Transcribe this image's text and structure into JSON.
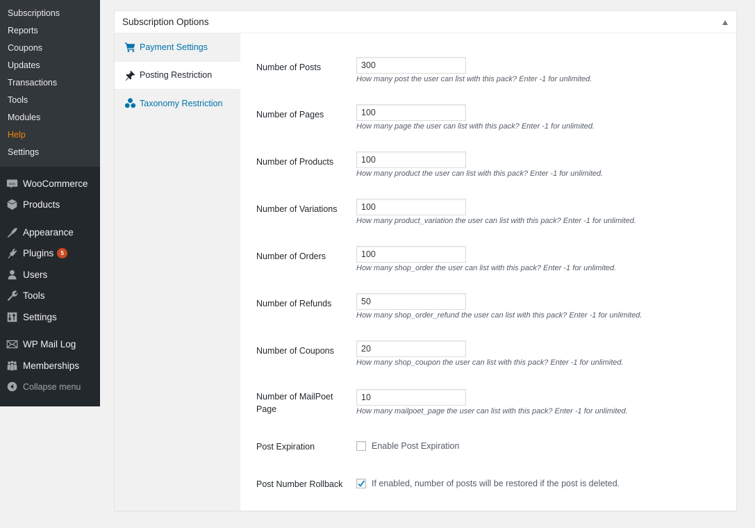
{
  "admin_menu": {
    "submenu": [
      {
        "label": "Subscriptions",
        "current": false
      },
      {
        "label": "Reports",
        "current": false
      },
      {
        "label": "Coupons",
        "current": false
      },
      {
        "label": "Updates",
        "current": false
      },
      {
        "label": "Transactions",
        "current": false
      },
      {
        "label": "Tools",
        "current": false
      },
      {
        "label": "Modules",
        "current": false
      },
      {
        "label": "Help",
        "current": true
      },
      {
        "label": "Settings",
        "current": false
      }
    ],
    "items": [
      {
        "label": "WooCommerce",
        "icon": "woocommerce-icon"
      },
      {
        "label": "Products",
        "icon": "products-box-icon"
      },
      {
        "label": "Appearance",
        "icon": "paintbrush-icon"
      },
      {
        "label": "Plugins",
        "icon": "plugin-plug-icon",
        "badge": "5"
      },
      {
        "label": "Users",
        "icon": "user-icon"
      },
      {
        "label": "Tools",
        "icon": "wrench-icon"
      },
      {
        "label": "Settings",
        "icon": "settings-sliders-icon"
      },
      {
        "label": "WP Mail Log",
        "icon": "envelope-icon"
      },
      {
        "label": "Memberships",
        "icon": "groups-icon"
      }
    ],
    "collapse_label": "Collapse menu"
  },
  "colors": {
    "sidebar_bg": "#23282d",
    "submenu_bg": "#32373c",
    "current_submenu": "#f18500",
    "link_blue": "#0073aa",
    "badge": "#ca4a1f",
    "check": "#1e8cbe"
  },
  "postbox": {
    "title": "Subscription Options",
    "tabs": [
      {
        "label": "Payment Settings",
        "icon": "cart-icon",
        "active": false
      },
      {
        "label": "Posting Restriction",
        "icon": "pushpin-icon",
        "active": true
      },
      {
        "label": "Taxonomy Restriction",
        "icon": "taxonomy-dots-icon",
        "active": false
      }
    ],
    "fields": [
      {
        "label": "Number of Posts",
        "value": "300",
        "desc": "How many post the user can list with this pack? Enter -1 for unlimited."
      },
      {
        "label": "Number of Pages",
        "value": "100",
        "desc": "How many page the user can list with this pack? Enter -1 for unlimited."
      },
      {
        "label": "Number of Products",
        "value": "100",
        "desc": "How many product the user can list with this pack? Enter -1 for unlimited."
      },
      {
        "label": "Number of Variations",
        "value": "100",
        "desc": "How many product_variation the user can list with this pack? Enter -1 for unlimited."
      },
      {
        "label": "Number of Orders",
        "value": "100",
        "desc": "How many shop_order the user can list with this pack? Enter -1 for unlimited."
      },
      {
        "label": "Number of Refunds",
        "value": "50",
        "desc": "How many shop_order_refund the user can list with this pack? Enter -1 for unlimited."
      },
      {
        "label": "Number of Coupons",
        "value": "20",
        "desc": "How many shop_coupon the user can list with this pack? Enter -1 for unlimited."
      },
      {
        "label": "Number of MailPoet Page",
        "value": "10",
        "desc": "How many mailpoet_page the user can list with this pack? Enter -1 for unlimited."
      }
    ],
    "post_expiration": {
      "label": "Post Expiration",
      "checkbox_label": "Enable Post Expiration",
      "checked": false
    },
    "post_rollback": {
      "label": "Post Number Rollback",
      "checkbox_label": "If enabled, number of posts will be restored if the post is deleted.",
      "checked": true
    }
  }
}
